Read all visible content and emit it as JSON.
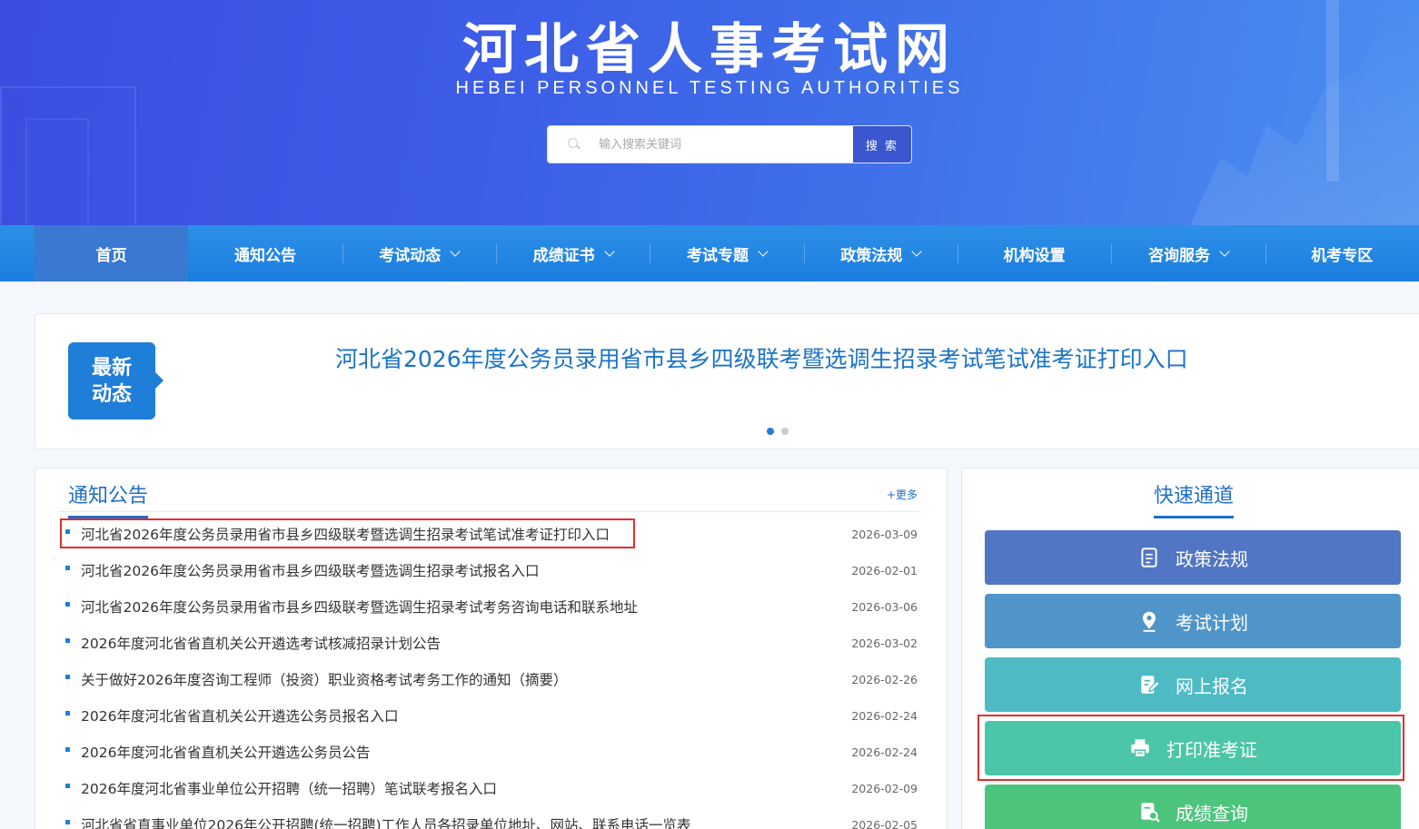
{
  "header": {
    "title": "河北省人事考试网",
    "subtitle": "HEBEI  PERSONNEL  TESTING AUTHORITIES",
    "search_placeholder": "输入搜索关键词",
    "search_button": "搜 索"
  },
  "nav": {
    "items": [
      {
        "label": "首页",
        "dropdown": false,
        "active": true
      },
      {
        "label": "通知公告",
        "dropdown": false
      },
      {
        "label": "考试动态",
        "dropdown": true
      },
      {
        "label": "成绩证书",
        "dropdown": true
      },
      {
        "label": "考试专题",
        "dropdown": true
      },
      {
        "label": "政策法规",
        "dropdown": true
      },
      {
        "label": "机构设置",
        "dropdown": false
      },
      {
        "label": "咨询服务",
        "dropdown": true
      },
      {
        "label": "机考专区",
        "dropdown": false
      }
    ]
  },
  "slider": {
    "badge": "最新 动态",
    "headline": "河北省2026年度公务员录用省市县乡四级联考暨选调生招录考试笔试准考证打印入口",
    "dots": 2,
    "active_dot": 0
  },
  "notices": {
    "title": "通知公告",
    "more": "+更多",
    "items": [
      {
        "text": "河北省2026年度公务员录用省市县乡四级联考暨选调生招录考试笔试准考证打印入口",
        "date": "2026-03-09",
        "highlighted": true
      },
      {
        "text": "河北省2026年度公务员录用省市县乡四级联考暨选调生招录考试报名入口",
        "date": "2026-02-01"
      },
      {
        "text": "河北省2026年度公务员录用省市县乡四级联考暨选调生招录考试考务咨询电话和联系地址",
        "date": "2026-03-06"
      },
      {
        "text": "2026年度河北省省直机关公开遴选考试核减招录计划公告",
        "date": "2026-03-02"
      },
      {
        "text": "关于做好2026年度咨询工程师（投资）职业资格考试考务工作的通知（摘要）",
        "date": "2026-02-26"
      },
      {
        "text": "2026年度河北省省直机关公开遴选公务员报名入口",
        "date": "2026-02-24"
      },
      {
        "text": "2026年度河北省省直机关公开遴选公务员公告",
        "date": "2026-02-24"
      },
      {
        "text": "2026年度河北省事业单位公开招聘（统一招聘）笔试联考报名入口",
        "date": "2026-02-09"
      },
      {
        "text": "河北省省直事业单位2026年公开招聘(统一招聘)工作人员各招录单位地址、网站、联系电话一览表",
        "date": "2026-02-05"
      }
    ]
  },
  "quick": {
    "title": "快速通道",
    "buttons": [
      {
        "label": "政策法规",
        "icon": "document-icon",
        "color": "#5176c4"
      },
      {
        "label": "考试计划",
        "icon": "location-pin-icon",
        "color": "#4f95c9"
      },
      {
        "label": "网上报名",
        "icon": "edit-form-icon",
        "color": "#4dbac4"
      },
      {
        "label": "打印准考证",
        "icon": "printer-icon",
        "color": "#4bc6a9",
        "highlighted": true
      },
      {
        "label": "成绩查询",
        "icon": "search-document-icon",
        "color": "#4dc47c"
      }
    ]
  }
}
